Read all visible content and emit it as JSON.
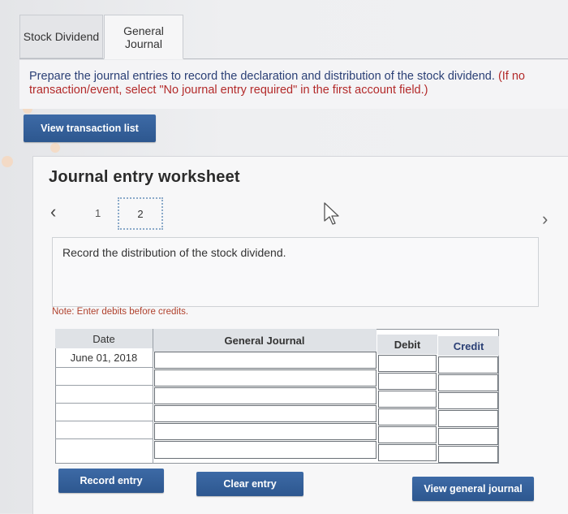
{
  "tabs": [
    {
      "label": "Stock Dividend"
    },
    {
      "label": "General Journal"
    }
  ],
  "instructions": {
    "text": "Prepare the journal entries to record the declaration and distribution of the stock dividend.",
    "hint": "(If no transaction/event, select \"No journal entry required\" in the first account field.)"
  },
  "buttons": {
    "view_transaction_list": "View transaction list",
    "record_entry": "Record entry",
    "clear_entry": "Clear entry",
    "view_general_journal": "View general journal"
  },
  "worksheet": {
    "title": "Journal entry worksheet",
    "pages": [
      "1",
      "2"
    ],
    "current_page": "2",
    "description": "Record the distribution of the stock dividend.",
    "note": "Note: Enter debits before credits."
  },
  "table": {
    "headers": [
      "Date",
      "General Journal",
      "Debit",
      "Credit"
    ],
    "rows": [
      {
        "date": "June 01, 2018",
        "account": "",
        "debit": "",
        "credit": ""
      },
      {
        "date": "",
        "account": "",
        "debit": "",
        "credit": ""
      },
      {
        "date": "",
        "account": "",
        "debit": "",
        "credit": ""
      },
      {
        "date": "",
        "account": "",
        "debit": "",
        "credit": ""
      },
      {
        "date": "",
        "account": "",
        "debit": "",
        "credit": ""
      },
      {
        "date": "",
        "account": "",
        "debit": "",
        "credit": ""
      }
    ]
  },
  "icons": {
    "prev": "chevron-left-icon",
    "next": "chevron-right-icon",
    "cursor": "mouse-pointer-icon"
  },
  "colors": {
    "button": "#2d578f",
    "instruction_text": "#2a3f75",
    "hint_text": "#b32a2a",
    "note_text": "#b0412d"
  }
}
